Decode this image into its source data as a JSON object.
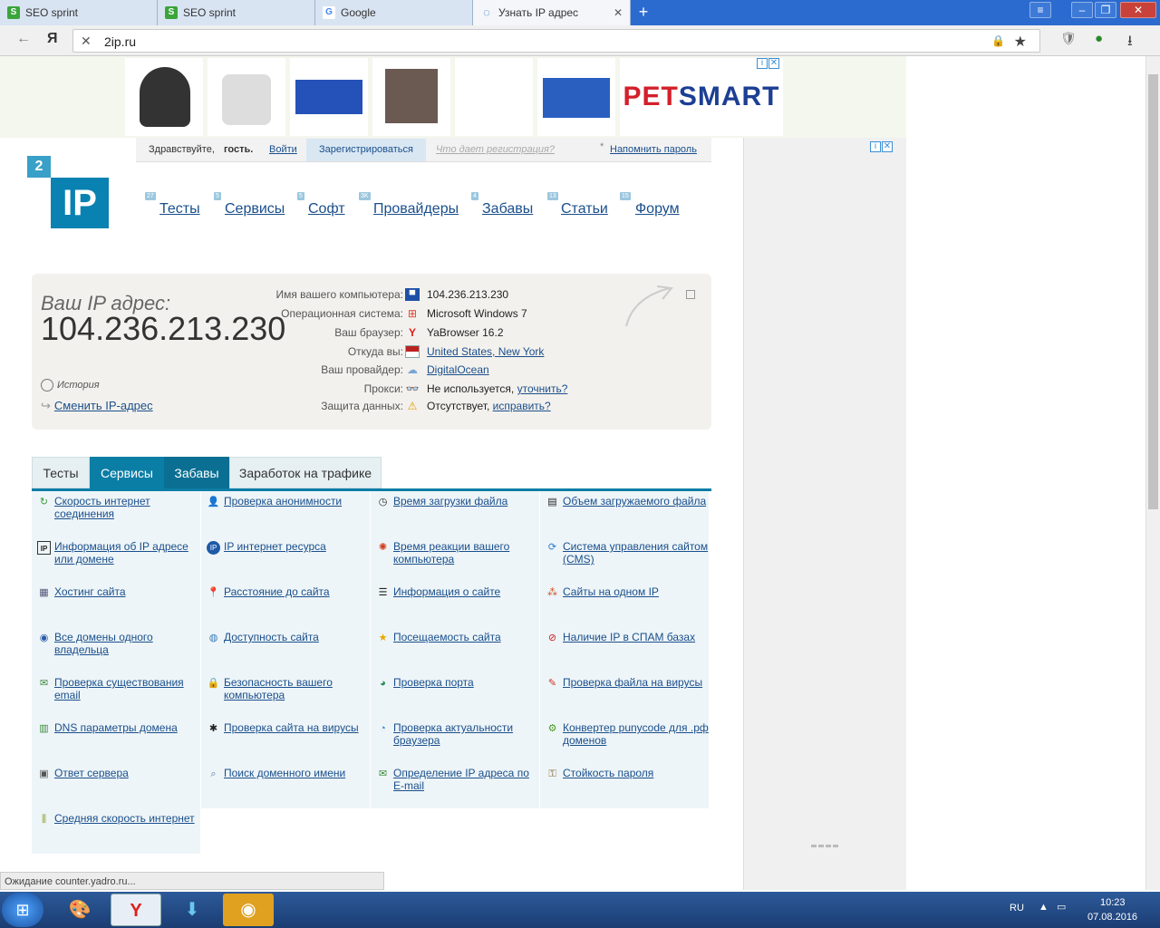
{
  "browser": {
    "tabs": [
      {
        "title": "SEO sprint"
      },
      {
        "title": "SEO sprint"
      },
      {
        "title": "Google"
      },
      {
        "title": "Узнать IP адрес"
      }
    ],
    "url": "2ip.ru",
    "yandex_label": "Я"
  },
  "ad": {
    "brand_a": "PET",
    "brand_b": "SMART"
  },
  "login": {
    "greeting": "Здравствуйте, ",
    "guest": "гость.",
    "login_link": "Войти",
    "register": "Зарегистрироваться",
    "why_register": "Что дает регистрация?",
    "remind_password": "Напомнить пароль"
  },
  "logo": {
    "badge": "2",
    "main": "IP"
  },
  "nav": [
    {
      "label": "Тесты",
      "badge": "27"
    },
    {
      "label": "Сервисы",
      "badge": "5"
    },
    {
      "label": "Софт",
      "badge": "5"
    },
    {
      "label": "Провайдеры",
      "badge": "3K"
    },
    {
      "label": "Забавы",
      "badge": "4"
    },
    {
      "label": "Статьи",
      "badge": "13"
    },
    {
      "label": "Форум",
      "badge": "15"
    }
  ],
  "ip_panel": {
    "label": "Ваш IP адрес:",
    "ip": "104.236.213.230",
    "history": "История",
    "change_ip": "Сменить IP-адрес",
    "rows": [
      {
        "key": "Имя вашего компьютера:",
        "value": "104.236.213.230",
        "link": ""
      },
      {
        "key": "Операционная система:",
        "value": "Microsoft Windows 7",
        "link": ""
      },
      {
        "key": "Ваш браузер:",
        "value": "YaBrowser 16.2",
        "link": ""
      },
      {
        "key": "Откуда вы:",
        "value": "",
        "link": "United States, New York"
      },
      {
        "key": "Ваш провайдер:",
        "value": "",
        "link": "DigitalOcean"
      },
      {
        "key": "Прокси:",
        "value": "Не используется, ",
        "link": "уточнить?"
      },
      {
        "key": "Защита данных:",
        "value": "Отсутствует, ",
        "link": "исправить?"
      }
    ]
  },
  "service_tabs": [
    "Тесты",
    "Сервисы",
    "Забавы",
    "Заработок на трафике"
  ],
  "services": [
    "Скорость интернет соединения",
    "Проверка анонимности",
    "Время загрузки файла",
    "Объем загружаемого файла",
    "Информация об IP адресе или домене",
    "IP интернет ресурса",
    "Время реакции вашего компьютера",
    "Система управления сайтом (CMS)",
    "Хостинг сайта",
    "Расстояние до сайта",
    "Информация о сайте",
    "Сайты на одном IP",
    "Все домены одного владельца",
    "Доступность сайта",
    "Посещаемость сайта",
    "Наличие IP в СПАМ базах",
    "Проверка существования email",
    "Безопасность вашего компьютера",
    "Проверка порта",
    "Проверка файла на вирусы",
    "DNS параметры домена",
    "Проверка сайта на вирусы",
    "Проверка актуальности браузера",
    "Конвертер punycode для .рф доменов",
    "Ответ сервера",
    "Поиск доменного имени",
    "Определение IP адреса по E-mail",
    "Стойкость пароля",
    "Средняя скорость интернет"
  ],
  "status_bar": "Ожидание counter.yadro.ru...",
  "tray": {
    "lang": "RU",
    "time": "10:23",
    "date": "07.08.2016"
  }
}
